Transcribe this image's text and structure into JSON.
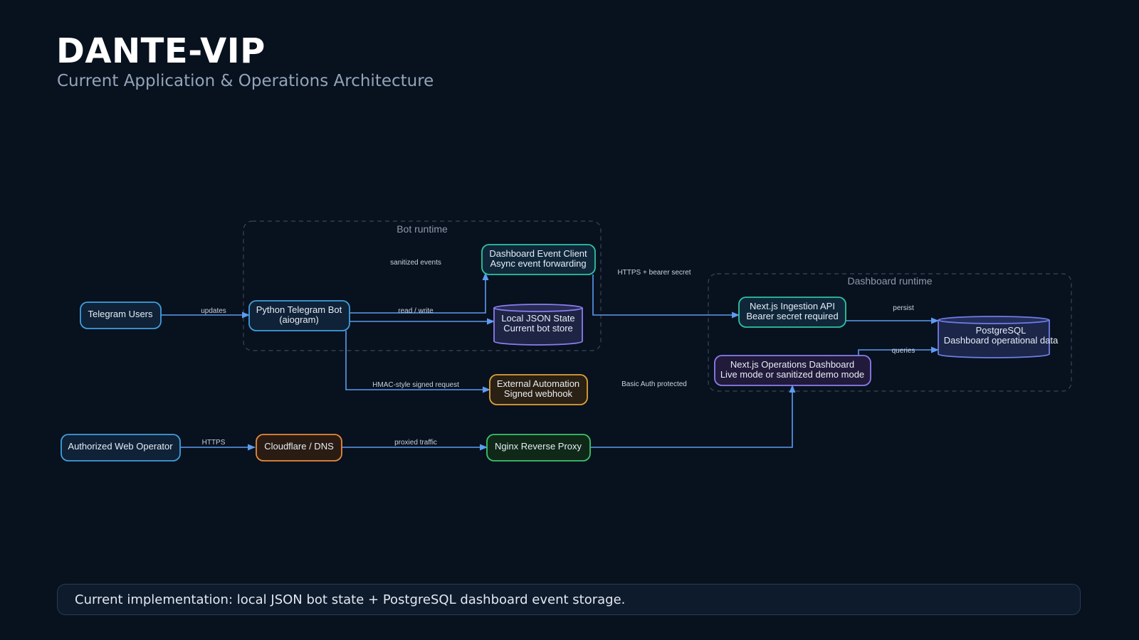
{
  "header": {
    "title": "DANTE-VIP",
    "subtitle": "Current Application & Operations Architecture"
  },
  "groups": {
    "bot_runtime": "Bot runtime",
    "dashboard_runtime": "Dashboard runtime"
  },
  "nodes": {
    "telegram_users": [
      "Telegram Users"
    ],
    "python_bot": [
      "Python Telegram Bot",
      "(aiogram)"
    ],
    "event_client": [
      "Dashboard Event Client",
      "Async event forwarding"
    ],
    "json_state": [
      "Local JSON State",
      "Current bot store"
    ],
    "external_automation": [
      "External Automation",
      "Signed webhook"
    ],
    "web_operator": [
      "Authorized Web Operator"
    ],
    "cloudflare": [
      "Cloudflare / DNS"
    ],
    "nginx": [
      "Nginx Reverse Proxy"
    ],
    "ingestion_api": [
      "Next.js Ingestion API",
      "Bearer secret required"
    ],
    "ops_dashboard": [
      "Next.js Operations Dashboard",
      "Live mode or sanitized demo mode"
    ],
    "postgres": [
      "PostgreSQL",
      "Dashboard operational data"
    ]
  },
  "edges": {
    "updates": "updates",
    "sanitized_events": "sanitized events",
    "read_write": "read / write",
    "https_bearer": "HTTPS + bearer secret",
    "persist": "persist",
    "queries": "queries",
    "hmac": "HMAC-style signed request",
    "basic_auth": "Basic Auth protected",
    "https": "HTTPS",
    "proxied": "proxied traffic"
  },
  "colors": {
    "background": "#08111e",
    "edge": "#5b9cf0",
    "blue_stroke": "#3f9fdd",
    "green_stroke": "#2ec4a0",
    "purple_stroke": "#8b7df0",
    "amber_stroke": "#e0a23a",
    "orange_stroke": "#e98a3a",
    "bright_green_stroke": "#3cc46a",
    "indigo_stroke": "#6f7de8"
  },
  "footer": {
    "text": "Current implementation: local JSON bot state + PostgreSQL dashboard event storage."
  }
}
